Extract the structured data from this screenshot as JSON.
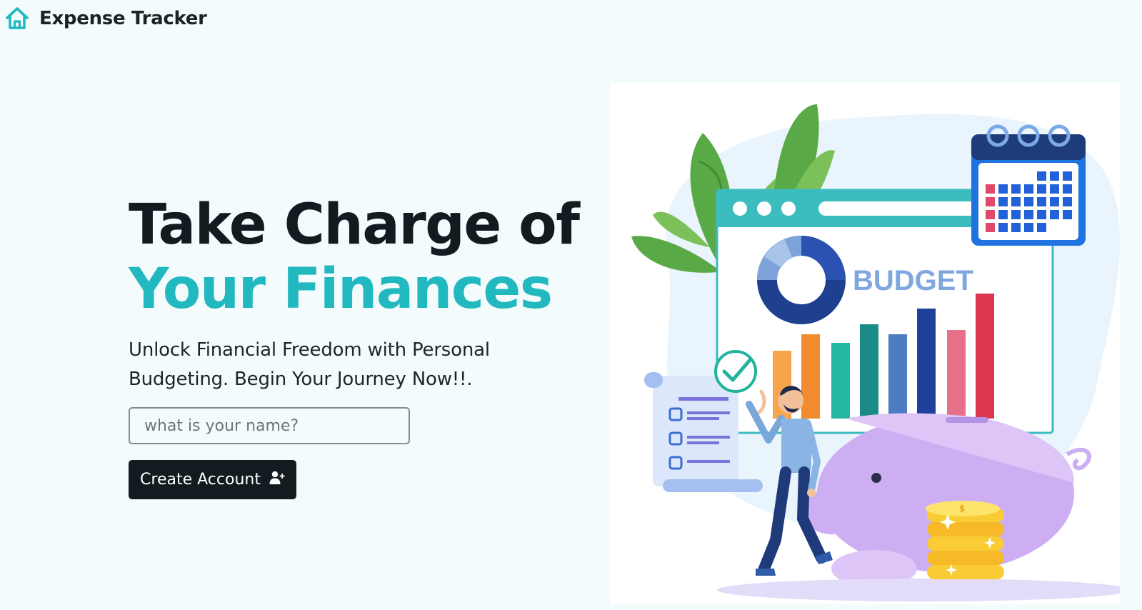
{
  "navbar": {
    "brand_name": "Expense Tracker",
    "brand_icon": "house-icon"
  },
  "hero": {
    "headline_line1": "Take Charge of",
    "headline_line2": "Your Finances",
    "subtitle": "Unlock Financial Freedom with Personal Budgeting. Begin Your Journey Now!!.",
    "name_input": {
      "value": "",
      "placeholder": "what is your name?"
    },
    "create_button": {
      "label": "Create Account",
      "icon": "user-plus-icon"
    }
  },
  "illustration": {
    "budget_label": "BUDGET",
    "bar_chart_colors": [
      "#f7a54a",
      "#f28b30",
      "#24b7a0",
      "#1c8a86",
      "#4d7cc0",
      "#1e3f9a",
      "#e8718a",
      "#dc3650"
    ]
  },
  "colors": {
    "accent": "#21b8c0",
    "dark": "#121b1f",
    "background": "#f4fbfc"
  }
}
